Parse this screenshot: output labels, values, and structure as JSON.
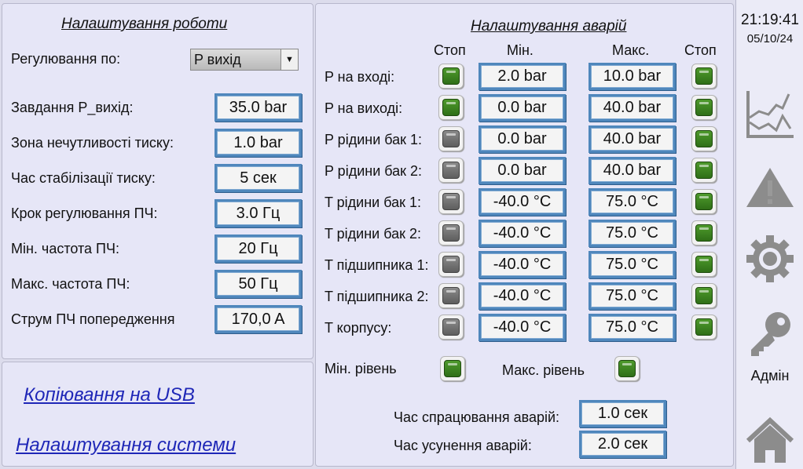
{
  "work_settings": {
    "title": "Налаштування роботи",
    "regulation_label": "Регулювання по:",
    "regulation_value": "P вихід",
    "rows": [
      {
        "label": "Завдання P_вихід:",
        "value": "35.0 bar"
      },
      {
        "label": "Зона нечутливості тиску:",
        "value": "1.0 bar"
      },
      {
        "label": "Час стабілізації тиску:",
        "value": "5 сек"
      },
      {
        "label": "Крок регулювання ПЧ:",
        "value": "3.0 Гц"
      },
      {
        "label": "Мін. частота ПЧ:",
        "value": "20 Гц"
      },
      {
        "label": "Макс. частота ПЧ:",
        "value": "50 Гц"
      },
      {
        "label": "Струм ПЧ попередження",
        "value": "170,0 A"
      }
    ]
  },
  "links": {
    "usb_copy": "Копіювання на USB",
    "system_settings": "Налаштування системи"
  },
  "alarm_settings": {
    "title": "Налаштування аварій",
    "headers": {
      "stop_left": "Стоп",
      "min": "Мін.",
      "max": "Макс.",
      "stop_right": "Стоп"
    },
    "rows": [
      {
        "label": "P на вході:",
        "stop_min": "on",
        "min": "2.0 bar",
        "max": "10.0 bar",
        "stop_max": "on"
      },
      {
        "label": "P на виході:",
        "stop_min": "on",
        "min": "0.0 bar",
        "max": "40.0 bar",
        "stop_max": "on"
      },
      {
        "label": "P рідини бак 1:",
        "stop_min": "off",
        "min": "0.0 bar",
        "max": "40.0 bar",
        "stop_max": "on"
      },
      {
        "label": "P рідини бак 2:",
        "stop_min": "off",
        "min": "0.0 bar",
        "max": "40.0 bar",
        "stop_max": "on"
      },
      {
        "label": "T рідини бак 1:",
        "stop_min": "off",
        "min": "-40.0 °C",
        "max": "75.0 °C",
        "stop_max": "on"
      },
      {
        "label": "T рідини бак 2:",
        "stop_min": "off",
        "min": "-40.0 °C",
        "max": "75.0 °C",
        "stop_max": "on"
      },
      {
        "label": "T підшипника 1:",
        "stop_min": "off",
        "min": "-40.0 °C",
        "max": "75.0 °C",
        "stop_max": "on"
      },
      {
        "label": "T підшипника 2:",
        "stop_min": "off",
        "min": "-40.0 °C",
        "max": "75.0 °C",
        "stop_max": "on"
      },
      {
        "label": "T корпусу:",
        "stop_min": "off",
        "min": "-40.0 °C",
        "max": "75.0 °C",
        "stop_max": "on"
      }
    ],
    "min_level_label": "Мін. рівень",
    "min_level_state": "on",
    "max_level_label": "Макс. рівень",
    "max_level_state": "on",
    "trigger_time_label": "Час спрацювання аварій:",
    "trigger_time_value": "1.0 сек",
    "clear_time_label": "Час усунення аварій:",
    "clear_time_value": "2.0 сек"
  },
  "sidebar": {
    "time": "21:19:41",
    "date": "05/10/24",
    "user_label": "Адмін",
    "icons": [
      "trend-chart-icon",
      "alarm-warning-icon",
      "settings-gear-icon",
      "login-key-icon",
      "home-icon"
    ]
  },
  "colors": {
    "field_border": "#4f87bc",
    "led_on": "#3f8a22",
    "led_off": "#6e6e6e",
    "link": "#1f27b7",
    "icon_gray": "#8c8c8c",
    "panel_bg": "#e6e6f7"
  }
}
